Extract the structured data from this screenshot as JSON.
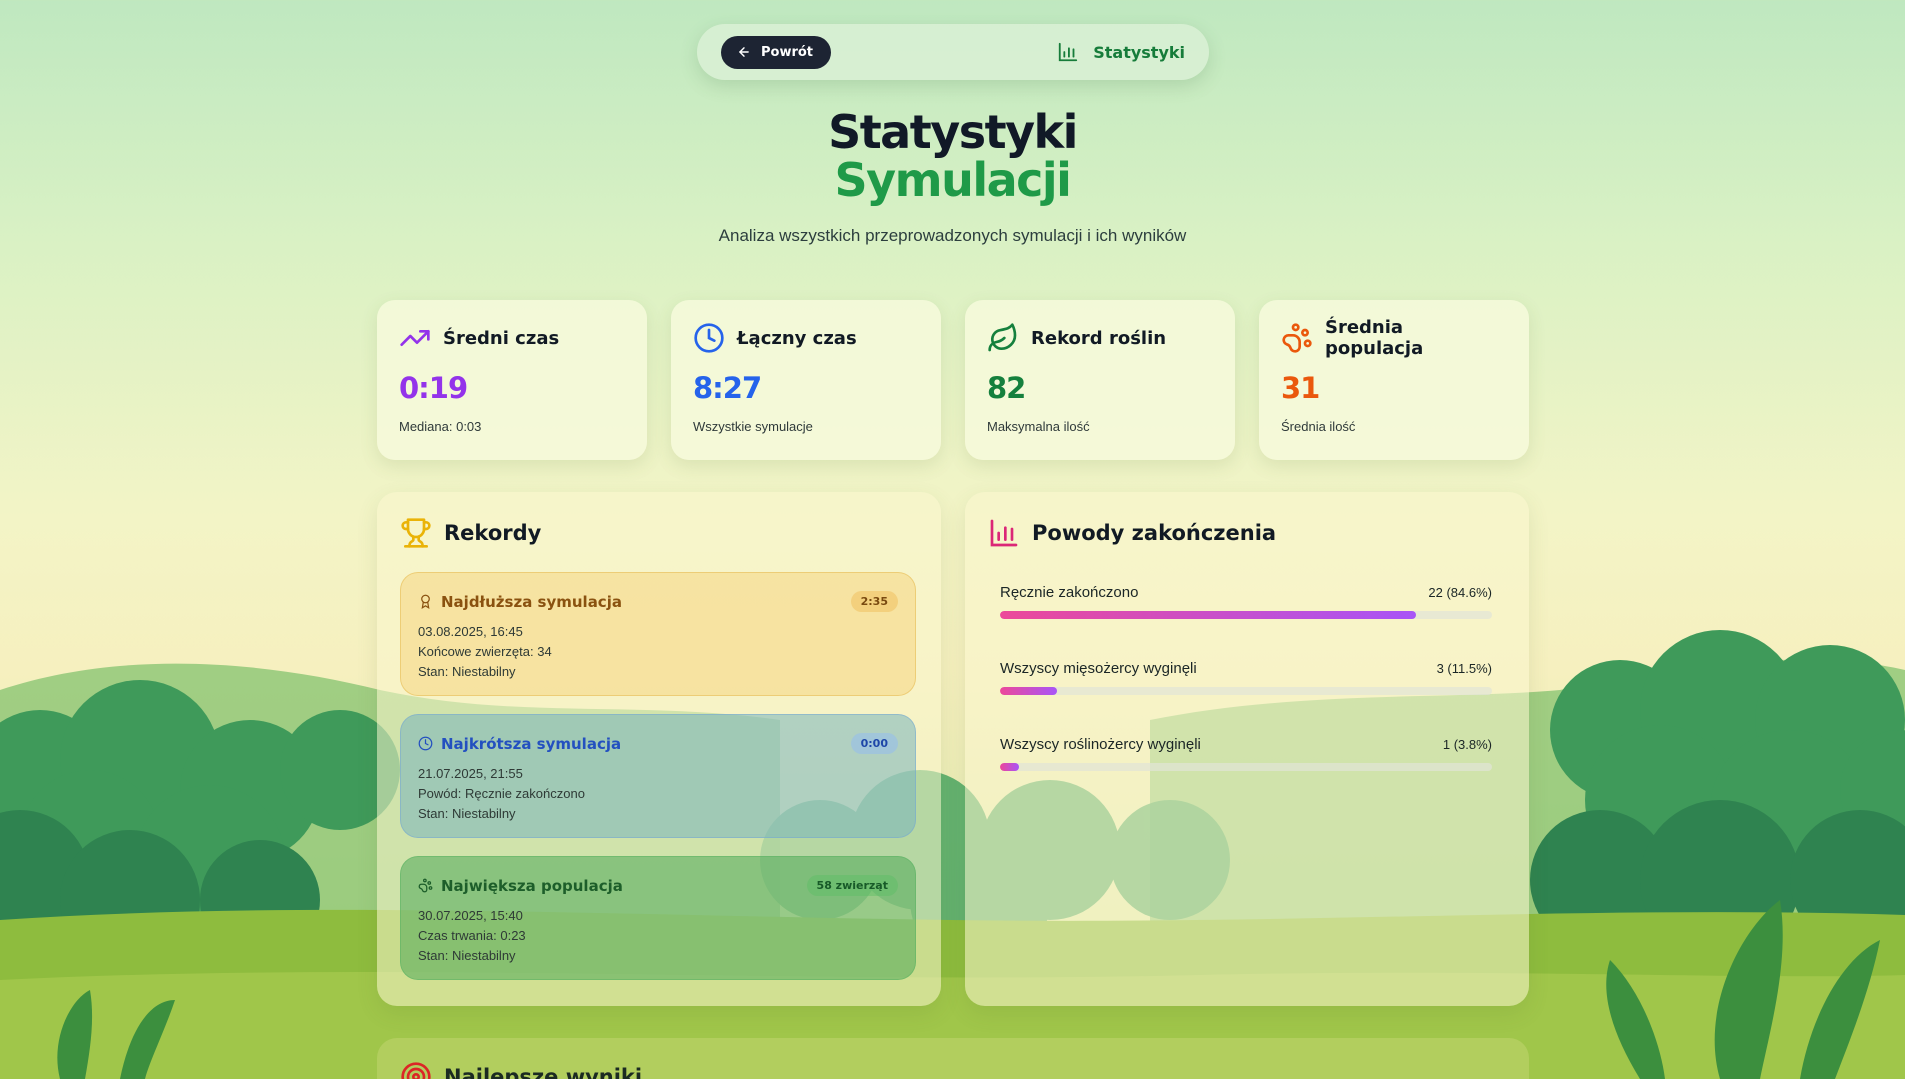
{
  "nav": {
    "back_label": "Powrót",
    "current_label": "Statystyki"
  },
  "header": {
    "title_line1": "Statystyki",
    "title_line2": "Symulacji",
    "subtitle": "Analiza wszystkich przeprowadzonych symulacji i ich wyników"
  },
  "stats": [
    {
      "icon": "trending-up-icon",
      "title": "Średni czas",
      "value": "0:19",
      "note": "Mediana: 0:03",
      "color": "#9333ea"
    },
    {
      "icon": "clock-icon",
      "title": "Łączny czas",
      "value": "8:27",
      "note": "Wszystkie symulacje",
      "color": "#2563eb"
    },
    {
      "icon": "leaf-icon",
      "title": "Rekord roślin",
      "value": "82",
      "note": "Maksymalna ilość",
      "color": "#15803d"
    },
    {
      "icon": "paw-icon",
      "title": "Średnia populacja",
      "value": "31",
      "note": "Średnia ilość",
      "color": "#ea580c"
    }
  ],
  "records": {
    "title": "Rekordy",
    "items": [
      {
        "icon": "award-icon",
        "name": "Najdłuższa symulacja",
        "badge": "2:35",
        "lines": [
          "03.08.2025, 16:45",
          "Końcowe zwierzęta: 34",
          "Stan: Niestabilny"
        ]
      },
      {
        "icon": "clock-icon",
        "name": "Najkrótsza symulacja",
        "badge": "0:00",
        "lines": [
          "21.07.2025, 21:55",
          "Powód: Ręcznie zakończono",
          "Stan: Niestabilny"
        ]
      },
      {
        "icon": "paw-icon",
        "name": "Największa populacja",
        "badge": "58 zwierząt",
        "lines": [
          "30.07.2025, 15:40",
          "Czas trwania: 0:23",
          "Stan: Niestabilny"
        ]
      }
    ]
  },
  "reasons": {
    "title": "Powody zakończenia",
    "items": [
      {
        "label": "Ręcznie zakończono",
        "value": "22 (84.6%)",
        "fraction": 0.846
      },
      {
        "label": "Wszyscy mięsożercy wyginęli",
        "value": "3 (11.5%)",
        "fraction": 0.115
      },
      {
        "label": "Wszyscy roślinożercy wyginęli",
        "value": "1 (3.8%)",
        "fraction": 0.038
      }
    ]
  },
  "best": {
    "title": "Najlepsze wyniki"
  },
  "colors": {
    "accent_green": "#1f9a48",
    "dark_button": "#1d2433",
    "bar_start": "#ec4899",
    "bar_end": "#a855f7"
  }
}
